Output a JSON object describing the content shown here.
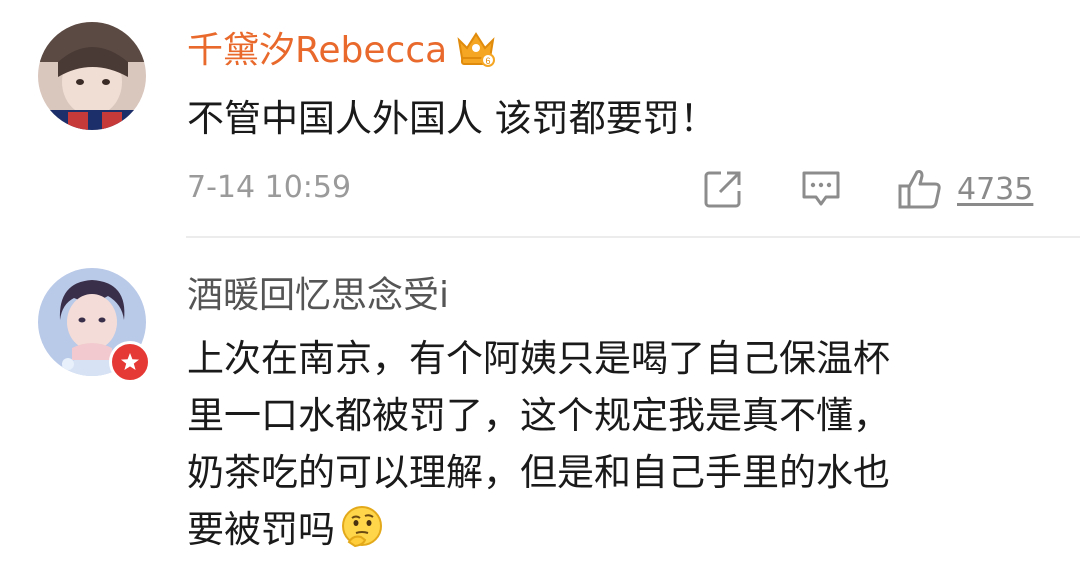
{
  "comments": [
    {
      "author": "千黛汐Rebecca",
      "text": "不管中国人外国人 该罚都要罚！",
      "timestamp": "7-14 10:59",
      "like_count": "4735",
      "icons": [
        "avatar",
        "crown-badge-icon",
        "share-icon",
        "reply-icon",
        "like-icon"
      ],
      "colors": {
        "author": "#e8692b"
      }
    },
    {
      "author": "酒暖回忆思念受i",
      "lines": [
        "上次在南京，有个阿姨只是喝了自己保温杯",
        "里一口水都被罚了，这个规定我是真不懂，",
        "奶茶吃的可以理解，但是和自己手里的水也",
        "要被罚吗"
      ],
      "icons": [
        "avatar",
        "verified-badge-icon",
        "thinking-emoji-icon"
      ],
      "colors": {
        "author": "#555555",
        "badge": "#e53935"
      }
    }
  ]
}
